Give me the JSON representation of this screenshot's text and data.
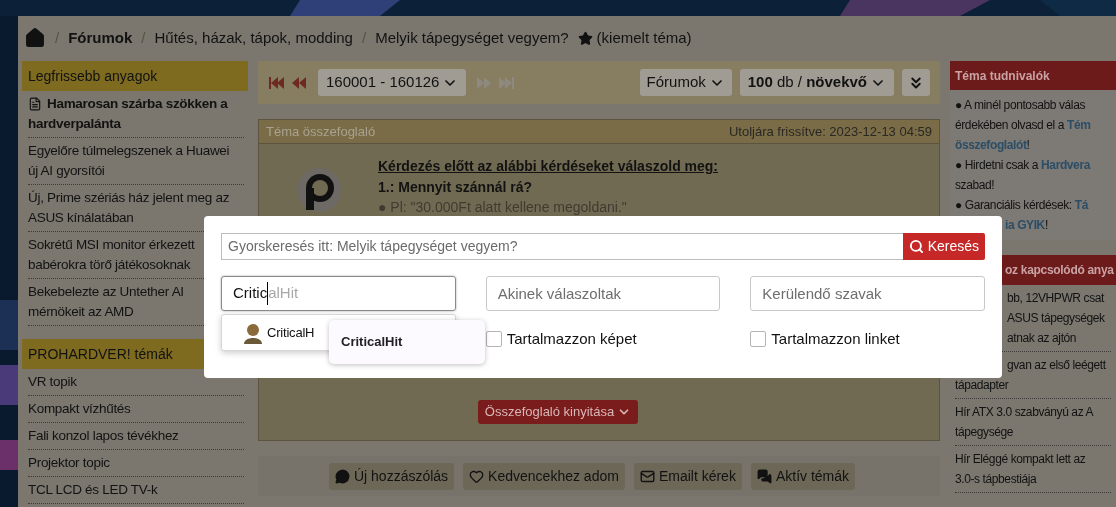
{
  "breadcrumb": {
    "separator": "/",
    "forum": "Fórumok",
    "path": [
      "Hűtés, házak, tápok, modding",
      "Melyik tápegységet vegyem?"
    ],
    "featured": "(kiemelt téma)"
  },
  "left_sidebar": [
    {
      "title": "Legfrissebb anyagok",
      "items": [
        {
          "kind": "article",
          "lines": [
            "Hamarosan szárba szökken a",
            "hardverpalánta"
          ]
        },
        {
          "kind": "plain",
          "lines": [
            "Egyelőre túlmelegszenek a Huawei",
            "új AI gyorsítói"
          ]
        },
        {
          "kind": "plain",
          "lines": [
            "Új, Prime szériás ház jelent meg az",
            "ASUS kínálatában"
          ]
        },
        {
          "kind": "plain",
          "lines": [
            "Sokrétű MSI monitor érkezett",
            "babérokra törő játékosoknak"
          ]
        },
        {
          "kind": "plain",
          "lines": [
            "Bekebelezte az Untether AI",
            "mérnökeit az AMD"
          ]
        }
      ]
    },
    {
      "title": "PROHARDVER! témák",
      "items": [
        {
          "kind": "plain",
          "lines": [
            "VR topik"
          ]
        },
        {
          "kind": "plain",
          "lines": [
            "Kompakt vízhűtés"
          ]
        },
        {
          "kind": "plain",
          "lines": [
            "Fali konzol lapos tévékhez"
          ]
        },
        {
          "kind": "plain",
          "lines": [
            "Projektor topic"
          ]
        },
        {
          "kind": "plain",
          "lines": [
            "TCL LCD és LED TV-k"
          ]
        }
      ]
    }
  ],
  "pager": {
    "nav": [
      {
        "kind": "first",
        "disabled": false
      },
      {
        "kind": "prev",
        "disabled": false
      },
      {
        "kind": "range",
        "label": "160001 - 160126"
      },
      {
        "kind": "next",
        "disabled": true
      },
      {
        "kind": "last",
        "disabled": true
      }
    ],
    "forum_select": "Fórumok",
    "order_select": "**100** db / **növekvő**"
  },
  "summary": {
    "title": "Téma összefoglaló",
    "updated": "Utoljára frissítve: 2023-12-13 04:59",
    "heading": "Kérdezés előtt az alábbi kérdéseket válaszold meg:",
    "question": "1.: Mennyit szánnál rá?",
    "example": "● Pl: \"30.000Ft alatt kellene megoldani.\"",
    "expand_button": "Összefoglaló kinyitása"
  },
  "actions": [
    {
      "kind": "comment",
      "label": "Új hozzászólás"
    },
    {
      "kind": "heart",
      "label": "Kedvencekhez adom"
    },
    {
      "kind": "mail",
      "label": "Emailt kérek"
    },
    {
      "kind": "chats",
      "label": "Aktív témák"
    }
  ],
  "right_sidebar": {
    "title": "Téma tudnivalók",
    "notes": [
      [
        {
          "kind": "text",
          "text": "● A minél pontosabb válas"
        }
      ],
      [
        {
          "kind": "text",
          "text": "érdekében olvasd el a "
        },
        {
          "kind": "link",
          "text": "Tém"
        }
      ],
      [
        {
          "kind": "link",
          "text": "összefoglalót"
        },
        {
          "kind": "text",
          "text": "!"
        }
      ],
      [
        {
          "kind": "text",
          "text": "● Hirdetni csak a "
        },
        {
          "kind": "link",
          "text": "Hardvera"
        }
      ],
      [
        {
          "kind": "text",
          "text": "szabad!"
        }
      ],
      [
        {
          "kind": "text",
          "text": "● Garanciális kérdések: "
        },
        {
          "kind": "link",
          "text": "Tá"
        }
      ]
    ],
    "covered_note": [
      {
        "kind": "link",
        "text": "ia GYIK"
      },
      {
        "kind": "text",
        "text": "!"
      }
    ],
    "related_title": "oz kapcsolódó anya",
    "related": [
      {
        "covered_lines": [
          "bb, 12VHPWR csat",
          "ASUS tápegységek",
          "atnak az ajtón"
        ]
      },
      {
        "covered_lines": [
          "gvan az első leégett"
        ],
        "lines": [
          "tápadapter"
        ]
      },
      {
        "lines": [
          "Hír ATX 3.0 szabványú az A",
          "tápegysége"
        ]
      },
      {
        "lines": [
          "Hír Eléggé kompakt lett az",
          "3.0-s tápbestiája"
        ]
      }
    ]
  },
  "search_dialog": {
    "quick_search": {
      "placeholder": "Gyorskeresés itt: Melyik tápegységet vegyem?"
    },
    "search_button": "Keresés",
    "author": {
      "value": "Critic",
      "suggestion": "alHit"
    },
    "replied_to": {
      "placeholder": "Akinek válaszoltak"
    },
    "excluded_words": {
      "placeholder": "Kerülendő szavak"
    },
    "author_dropdown": {
      "item": "CriticalH",
      "tooltip": "CriticalHit"
    },
    "options": [
      {
        "label": "Tartalmazzon képet",
        "checked": false
      },
      {
        "label": "Tartalmazzon linket",
        "checked": false
      }
    ]
  }
}
